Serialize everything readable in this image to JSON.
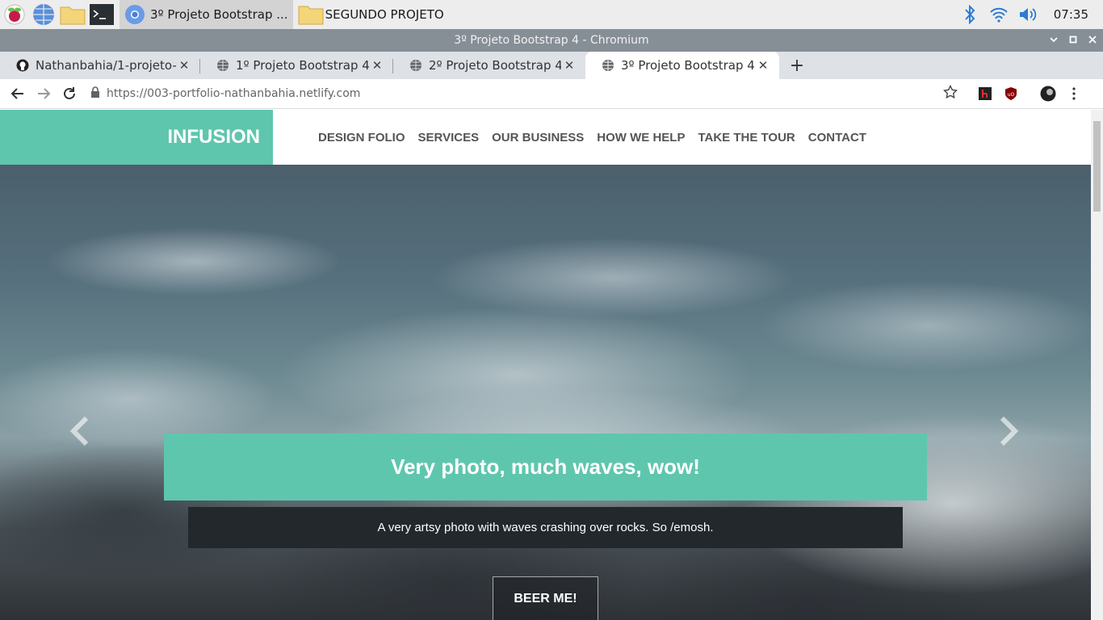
{
  "taskbar": {
    "tasks": [
      {
        "label": "3º Projeto Bootstrap ...",
        "active": true
      },
      {
        "label": "SEGUNDO PROJETO",
        "active": false
      }
    ],
    "clock": "07:35"
  },
  "window": {
    "title": "3º Projeto Bootstrap 4 - Chromium"
  },
  "browser": {
    "tabs": [
      {
        "label": "Nathanbahia/1-projeto-b"
      },
      {
        "label": "1º Projeto Bootstrap 4"
      },
      {
        "label": "2º Projeto Bootstrap 4"
      },
      {
        "label": "3º Projeto Bootstrap 4"
      }
    ],
    "url": "https://003-portfolio-nathanbahia.netlify.com"
  },
  "site": {
    "brand": "INFUSION",
    "menu": [
      "DESIGN FOLIO",
      "SERVICES",
      "OUR BUSINESS",
      "HOW WE HELP",
      "TAKE THE TOUR",
      "CONTACT"
    ],
    "hero": {
      "title": "Very photo, much waves, wow!",
      "text": "A very artsy photo with waves crashing over rocks. So /emosh.",
      "button": "BEER ME!"
    }
  },
  "colors": {
    "accent": "#5fc6ae",
    "caption_dark": "#23282c"
  }
}
